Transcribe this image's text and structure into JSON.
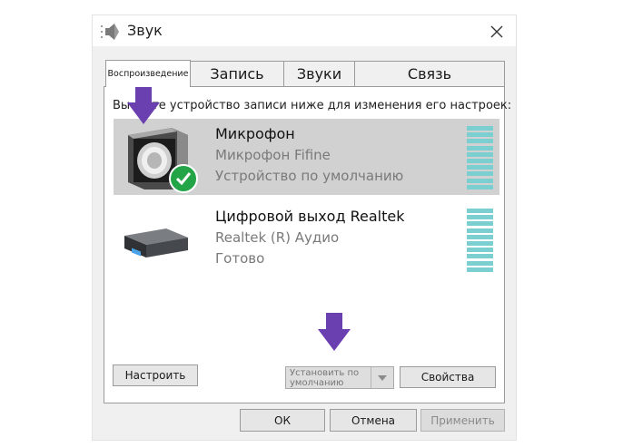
{
  "window": {
    "title": "Звук",
    "close_symbol": "✕"
  },
  "tabs": [
    {
      "label": "Воспроизведение",
      "active": true
    },
    {
      "label": "Запись",
      "active": false
    },
    {
      "label": "Звуки",
      "active": false
    },
    {
      "label": "Связь",
      "active": false
    }
  ],
  "panel": {
    "instruction_prefix": "Вы",
    "instruction_suffix": "те устройство записи ниже для изменения его настроек:"
  },
  "devices": [
    {
      "name": "Микрофон",
      "description": "Микрофон Fifine",
      "status": "Устройство по умолчанию",
      "selected": true,
      "icon": "microphone-device-icon"
    },
    {
      "name": "Цифровой выход Realtek",
      "description": "Realtek (R) Аудио",
      "status": "Готово",
      "selected": false,
      "icon": "digital-output-device-icon"
    }
  ],
  "buttons": {
    "configure": "Настроить",
    "set_default": "Установить по умолчанию",
    "properties": "Свойства",
    "ok": "ОК",
    "cancel": "Отмена",
    "apply": "Применить"
  },
  "colors": {
    "accent_arrow": "#6a3fb0",
    "meter": "#7ccfd0",
    "selection": "#d1d1d1",
    "default_check": "#22a447"
  }
}
